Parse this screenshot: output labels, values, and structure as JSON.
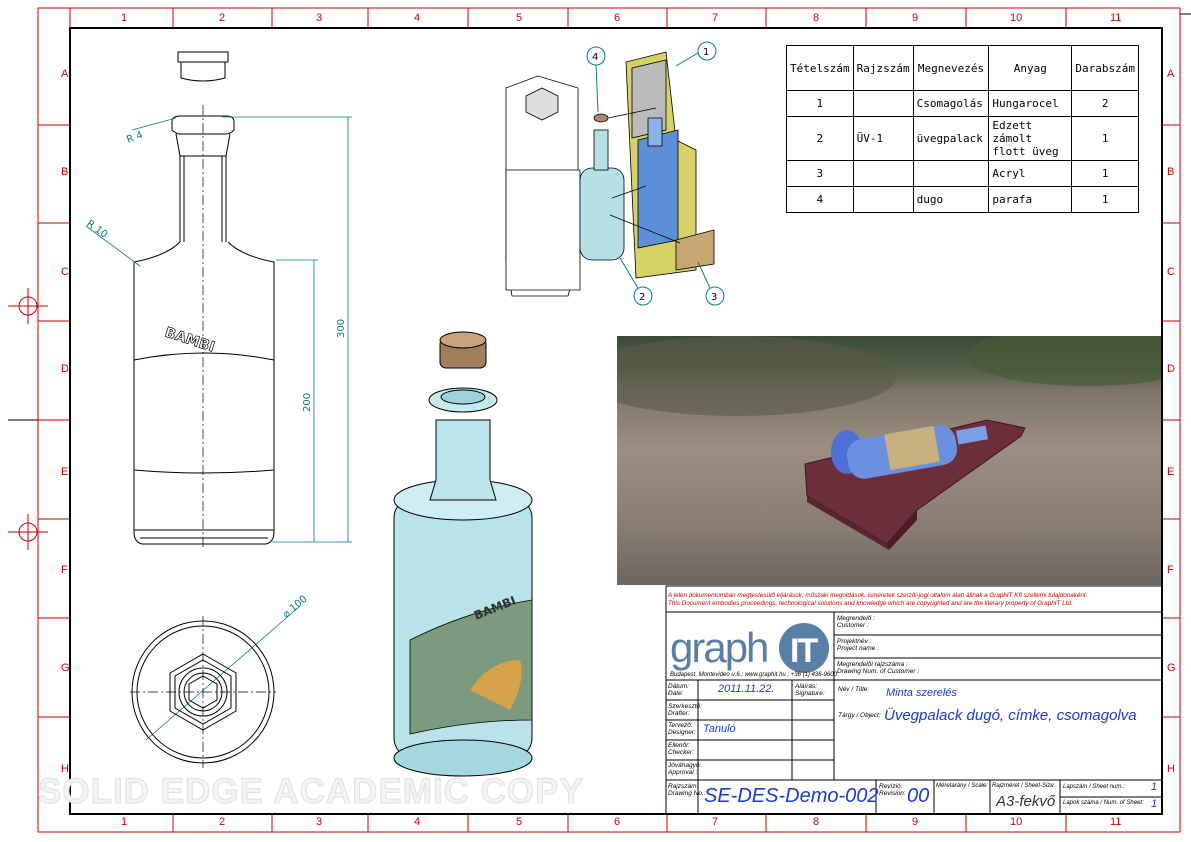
{
  "sheet": {
    "zone_columns": [
      "1",
      "2",
      "3",
      "4",
      "5",
      "6",
      "7",
      "8",
      "9",
      "10",
      "11"
    ],
    "zone_rows": [
      "A",
      "B",
      "C",
      "D",
      "E",
      "F",
      "G",
      "H"
    ],
    "border_color": "#cc0000",
    "dim_color": "#008080"
  },
  "drawing_front": {
    "bottle_text": "BAMBI",
    "dims": {
      "r4": "R 4",
      "r10": "R 10",
      "h300": "300",
      "h200": "200",
      "d100": "100"
    }
  },
  "balloons": [
    "1",
    "2",
    "3",
    "4"
  ],
  "bom": {
    "headers": [
      "Tételszám",
      "Rajzszám",
      "Megnevezés",
      "Anyag",
      "Darabszám"
    ],
    "rows": [
      {
        "pos": "1",
        "drawing_no": "",
        "name": "Csomagolás",
        "material": "Hungarocel",
        "qty": "2"
      },
      {
        "pos": "2",
        "drawing_no": "ÜV-1",
        "name": "üvegpalack",
        "material": "Edzett zámolt flott üveg",
        "qty": "1"
      },
      {
        "pos": "3",
        "drawing_no": "",
        "name": "",
        "material": "Acryl",
        "qty": "1"
      },
      {
        "pos": "4",
        "drawing_no": "",
        "name": "dugo",
        "material": "parafa",
        "qty": "1"
      }
    ]
  },
  "title_block": {
    "notice_hu": "A jelen dokumentumban megtestesülő eljárások, műszaki megoldások, ismeretek szerzői-jogi oltalom alatt állnak a GraphIT Kft szellemi tulajdonaként.",
    "notice_en": "This Document embodies proceedings, technological solutions and knowledge which are copyrighted and are the literary property of GraphIT Ltd.",
    "logo_text": "graphIT",
    "address": "Budapest, Montevideo u.6.; www.graphit.hu ; +36 (1) 436-9600",
    "labels": {
      "customer": "Megrendelő :\nCustomer :",
      "project": "Projektnév :\nProject name :",
      "customer_num": "Megrendelői rajzszáma :\nDrawing Num. of Customer :",
      "date": "Dátum:\nDate:",
      "signature": "Aláírás:\nSignature:",
      "drafter": "Szerkesztő:\nDrafter:",
      "designer": "Tervező:\nDesigner:",
      "checker": "Ellenőr:\nChecker:",
      "approval": "Jóváhagyó:\nApproval :",
      "title": "Név / Title:",
      "object": "Tárgy / Object:",
      "drawing_no": "Rajzszám:\nDrawing No.:",
      "revision": "Revízió:\nRevision:",
      "scale": "Méretarány / Scale:",
      "sheet_size": "Rajzméret / Sheet-Size:",
      "sheet_num": "Lapszám / Sheet num.:",
      "num_sheets": "Lapok száma / Num. of Sheet:"
    },
    "date": "2011.11.22.",
    "designer": "Tanuló",
    "title": "Minta szerelés",
    "object": "Üvegpalack dugó, címke, csomagolva",
    "drawing_no": "SE-DES-Demo-002",
    "revision": "00",
    "sheet_size": "A3-fekvő",
    "sheet_num": "1",
    "num_sheets": "1"
  },
  "watermark": "SOLID EDGE ACADEMIC COPY"
}
